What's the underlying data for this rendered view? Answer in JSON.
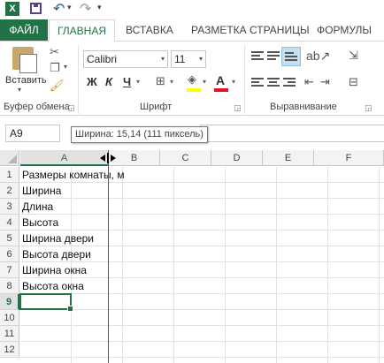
{
  "app": {
    "logo_letter": "X"
  },
  "tabs": {
    "file": "ФАЙЛ",
    "home": "ГЛАВНАЯ",
    "insert": "ВСТАВКА",
    "page_layout": "РАЗМЕТКА СТРАНИЦЫ",
    "formulas": "ФОРМУЛЫ"
  },
  "ribbon": {
    "paste_label": "Вставить",
    "clipboard_group": "Буфер обмена",
    "font_group": "Шрифт",
    "alignment_group": "Выравнивание",
    "font_name": "Calibri",
    "font_size": "11",
    "bold": "Ж",
    "italic": "К",
    "underline": "Ч",
    "font_color_letter": "A"
  },
  "formula_bar": {
    "name_box": "A9",
    "tooltip": "Ширина: 15,14 (111 пиксель)"
  },
  "grid": {
    "columns": [
      "A",
      "B",
      "C",
      "D",
      "E",
      "F"
    ],
    "selected_column": "A",
    "rows": [
      "1",
      "2",
      "3",
      "4",
      "5",
      "6",
      "7",
      "8",
      "9",
      "10",
      "11",
      "12"
    ],
    "selected_row": "9",
    "cells": [
      "Размеры комнаты, м",
      "Ширина",
      "Длина",
      "Высота",
      "Ширина двери",
      "Высота двери",
      "Ширина окна",
      "Высота окна"
    ]
  },
  "colors": {
    "accent": "#217346",
    "font_color_bar": "#e81123",
    "highlight_bar": "#ffff00"
  },
  "icons": [
    "excel-logo-icon",
    "save-icon",
    "undo-icon",
    "redo-icon",
    "customize-qat-icon",
    "paste-icon",
    "cut-icon",
    "copy-icon",
    "format-painter-icon",
    "border-icon",
    "fill-color-icon",
    "font-color-icon",
    "align-top-icon",
    "align-middle-icon",
    "align-bottom-icon",
    "orientation-icon",
    "wrap-text-icon",
    "align-left-icon",
    "align-center-icon",
    "align-right-icon",
    "merge-icon",
    "column-resize-icon"
  ]
}
